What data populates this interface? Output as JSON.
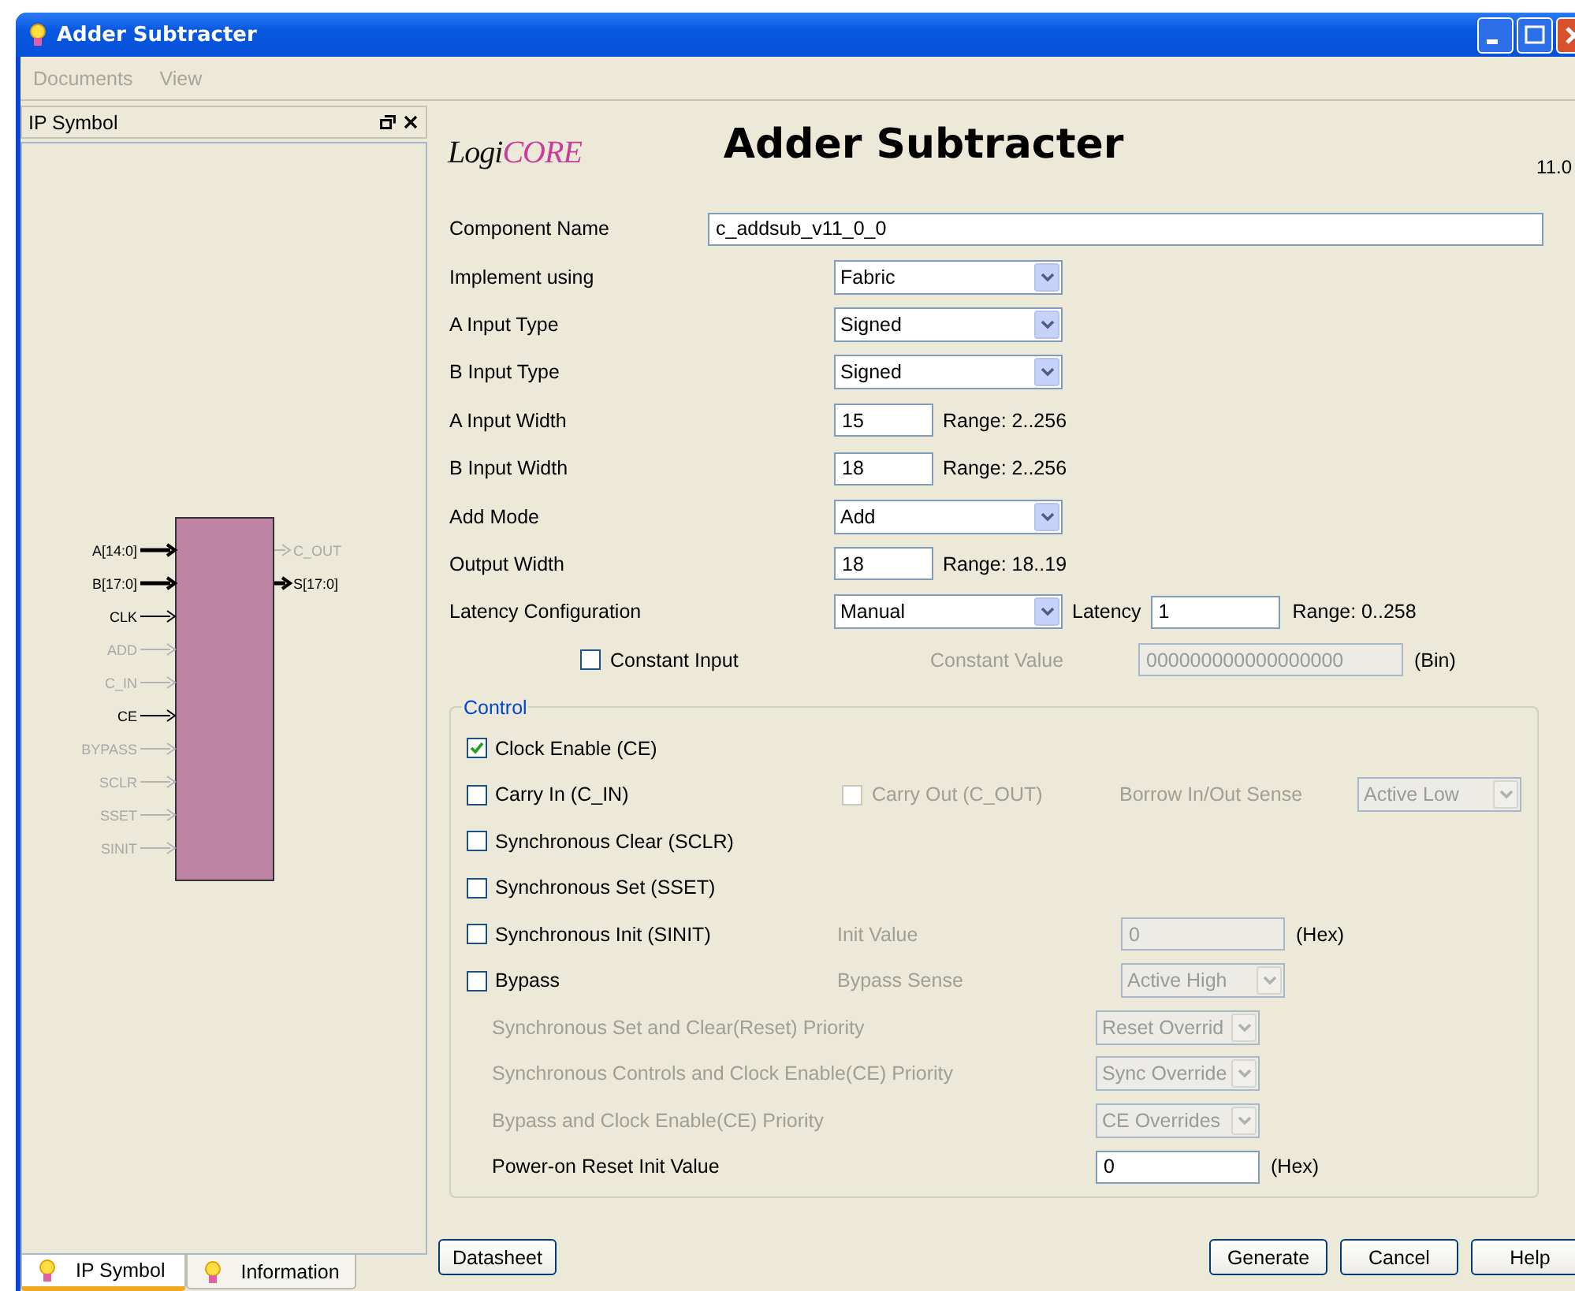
{
  "window": {
    "title": "Adder Subtracter"
  },
  "menu": [
    {
      "label": "Documents",
      "disabled": true
    },
    {
      "label": "View",
      "disabled": true
    }
  ],
  "side_panel": {
    "title": "IP Symbol",
    "symbol": {
      "inputs": [
        {
          "label": "A[14:0]",
          "enabled": true,
          "bus": true
        },
        {
          "label": "B[17:0]",
          "enabled": true,
          "bus": true
        },
        {
          "label": "CLK",
          "enabled": true,
          "bus": false
        },
        {
          "label": "ADD",
          "enabled": false,
          "bus": false
        },
        {
          "label": "C_IN",
          "enabled": false,
          "bus": false
        },
        {
          "label": "CE",
          "enabled": true,
          "bus": false
        },
        {
          "label": "BYPASS",
          "enabled": false,
          "bus": false
        },
        {
          "label": "SCLR",
          "enabled": false,
          "bus": false
        },
        {
          "label": "SSET",
          "enabled": false,
          "bus": false
        },
        {
          "label": "SINIT",
          "enabled": false,
          "bus": false
        }
      ],
      "outputs": [
        {
          "label": "C_OUT",
          "enabled": false,
          "bus": false
        },
        {
          "label": "S[17:0]",
          "enabled": true,
          "bus": true
        }
      ]
    },
    "tabs": [
      {
        "label": "IP Symbol",
        "selected": true
      },
      {
        "label": "Information",
        "selected": false
      }
    ]
  },
  "header": {
    "logo": {
      "prefix": "Logi",
      "suffix": "CORE"
    },
    "title": "Adder Subtracter",
    "version": "11.0"
  },
  "form": [
    {
      "kind": "text",
      "label": "Component Name",
      "value": "c_addsub_v11_0_0"
    },
    {
      "kind": "select",
      "label": "Implement using",
      "value": "Fabric"
    },
    {
      "kind": "select",
      "label": "A Input Type",
      "value": "Signed"
    },
    {
      "kind": "select",
      "label": "B Input Type",
      "value": "Signed"
    },
    {
      "kind": "number",
      "label": "A Input Width",
      "value": "15",
      "range": "Range: 2..256"
    },
    {
      "kind": "number",
      "label": "B Input Width",
      "value": "18",
      "range": "Range: 2..256"
    },
    {
      "kind": "select",
      "label": "Add Mode",
      "value": "Add"
    },
    {
      "kind": "number",
      "label": "Output Width",
      "value": "18",
      "range": "Range: 18..19"
    },
    {
      "kind": "latency",
      "label": "Latency Configuration",
      "value": "Manual",
      "sub_label": "Latency",
      "sub_value": "1",
      "range": "Range: 0..258"
    }
  ],
  "constant_input": {
    "label": "Constant Input",
    "checked": false,
    "value_label": "Constant Value",
    "value": "000000000000000000",
    "unit": "(Bin)",
    "disabled": true
  },
  "control": {
    "title": "Control",
    "rows": [
      {
        "kind": "check",
        "label": "Clock Enable (CE)",
        "checked": true
      },
      {
        "kind": "carry",
        "label": "Carry In (C_IN)",
        "checked": false,
        "secondary": {
          "label": "Carry Out (C_OUT)",
          "checked": false,
          "disabled": true
        },
        "option_label": "Borrow In/Out Sense",
        "option_value": "Active Low",
        "disabled": true
      },
      {
        "kind": "check",
        "label": "Synchronous Clear (SCLR)",
        "checked": false
      },
      {
        "kind": "check",
        "label": "Synchronous Set (SSET)",
        "checked": false
      },
      {
        "kind": "check_text",
        "label": "Synchronous Init (SINIT)",
        "checked": false,
        "option_label": "Init Value",
        "option_value": "0",
        "unit": "(Hex)",
        "disabled": true
      },
      {
        "kind": "check_select",
        "label": "Bypass",
        "checked": false,
        "option_label": "Bypass Sense",
        "option_value": "Active High",
        "disabled": true
      },
      {
        "kind": "option_select",
        "label": "Synchronous Set and Clear(Reset) Priority",
        "value": "Reset Overrid",
        "disabled": true
      },
      {
        "kind": "option_select",
        "label": "Synchronous Controls and Clock Enable(CE) Priority",
        "value": "Sync Override",
        "disabled": true
      },
      {
        "kind": "option_select",
        "label": "Bypass and Clock Enable(CE) Priority",
        "value": "CE Overrides",
        "disabled": true
      },
      {
        "kind": "option_text",
        "label": "Power-on Reset Init Value",
        "value": "0",
        "unit": "(Hex)",
        "disabled": false
      }
    ]
  },
  "buttons": {
    "left": [
      {
        "label": "Datasheet"
      }
    ],
    "right": [
      {
        "label": "Generate"
      },
      {
        "label": "Cancel"
      },
      {
        "label": "Help"
      }
    ]
  }
}
